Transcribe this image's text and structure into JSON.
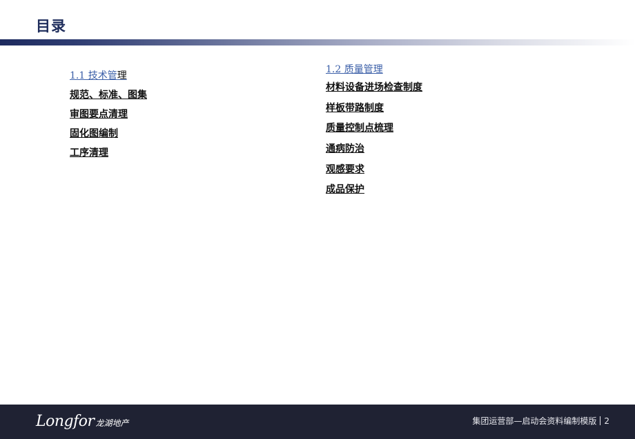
{
  "title": "目录",
  "left_column": {
    "heading_prefix": "1.1 技术管",
    "heading_suffix": "理",
    "items": [
      "规范、标准、图集",
      "审图要点清理",
      "固化图编制",
      "工序清理"
    ]
  },
  "right_column": {
    "heading": "1.2 质量管理",
    "items": [
      "材料设备进场检查制度",
      "样板带路制度",
      "质量控制点梳理",
      "通病防治",
      "观感要求",
      "成品保护"
    ]
  },
  "footer": {
    "logo_text": "Longfor",
    "logo_cn": "龙湖地产",
    "caption": "集团运营部—启动会资料编制模版",
    "page_number": "2"
  },
  "colors": {
    "title": "#1f2d5c",
    "heading_link": "#3b5fa8",
    "footer_bg": "#1f2233"
  }
}
